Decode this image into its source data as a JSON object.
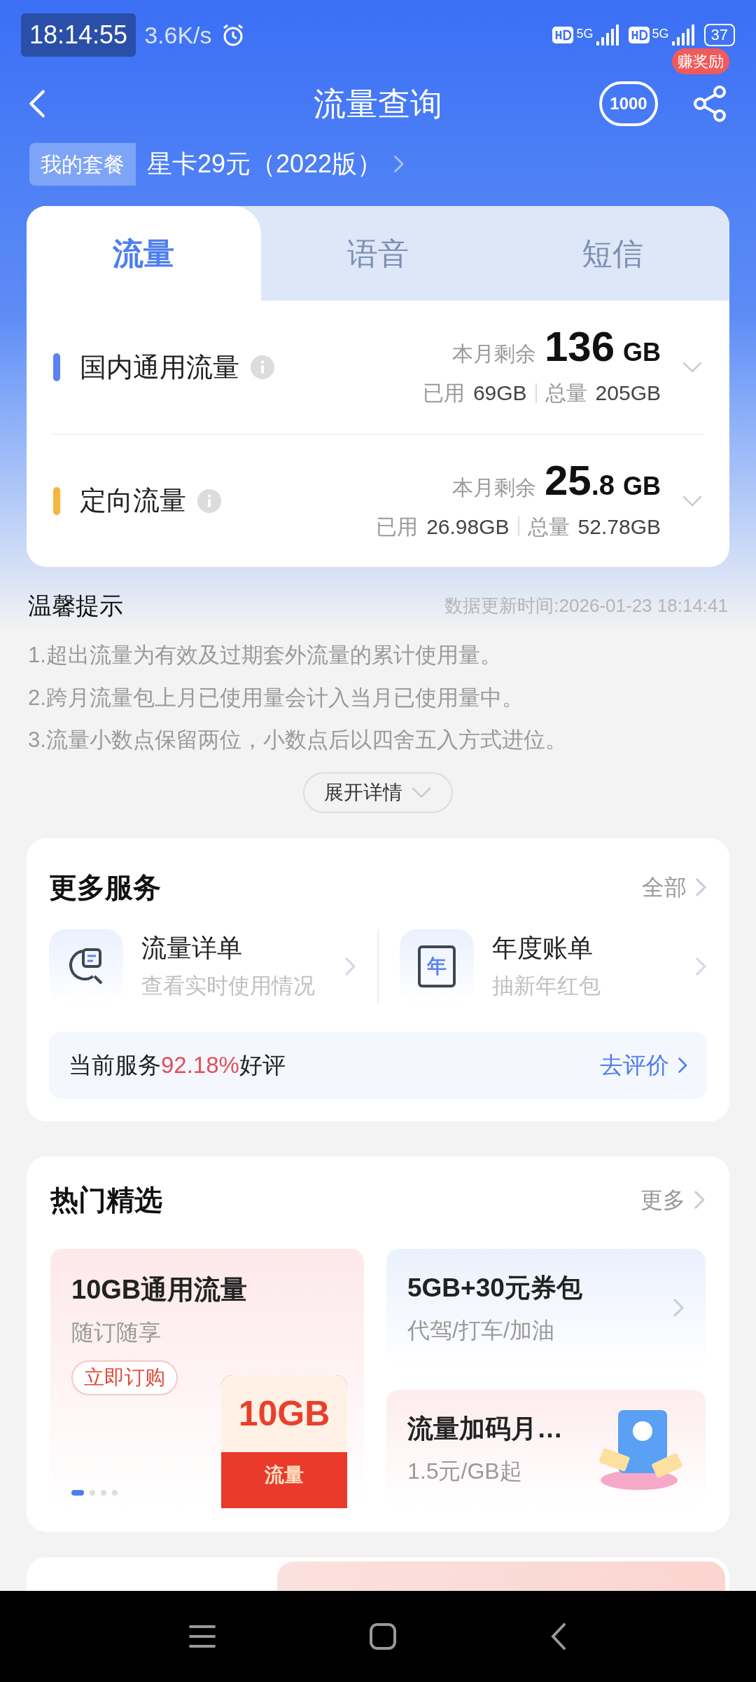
{
  "status_bar": {
    "time": "18:14:55",
    "speed": "3.6K/s",
    "network_1": "5G",
    "network_2": "5G",
    "battery": "37"
  },
  "header": {
    "title": "流量查询",
    "service_badge": "1000",
    "reward_badge": "赚奖励"
  },
  "plan": {
    "label": "我的套餐",
    "name": "星卡29元（2022版）"
  },
  "tabs": [
    {
      "label": "流量",
      "selected": true
    },
    {
      "label": "语音",
      "selected": false
    },
    {
      "label": "短信",
      "selected": false
    }
  ],
  "usage": [
    {
      "name": "国内通用流量",
      "color": "#5b82f0",
      "remain_label": "本月剩余",
      "value": "136",
      "unit": "GB",
      "used_label": "已用",
      "used": "69GB",
      "total_label": "总量",
      "total": "205GB"
    },
    {
      "name": "定向流量",
      "color": "#f5b540",
      "remain_label": "本月剩余",
      "value": "25",
      "fraction": ".8",
      "unit": "GB",
      "used_label": "已用",
      "used": "26.98GB",
      "total_label": "总量",
      "total": "52.78GB"
    }
  ],
  "tips": {
    "title": "温馨提示",
    "updated": "数据更新时间:2026-01-23 18:14:41",
    "items": [
      "1.超出流量为有效及过期套外流量的累计使用量。",
      "2.跨月流量包上月已使用量会计入当月已使用量中。",
      "3.流量小数点保留两位，小数点后以四舍五入方式进位。"
    ],
    "expand": "展开详情"
  },
  "services": {
    "title": "更多服务",
    "more": "全部",
    "items": [
      {
        "kind": "search",
        "title": "流量详单",
        "subtitle": "查看实时使用情况"
      },
      {
        "kind": "calendar",
        "title": "年度账单",
        "subtitle": "抽新年红包",
        "icon_text": "年"
      }
    ],
    "rating_prefix": "当前服务",
    "rating_value": "92.18%",
    "rating_suffix": "好评",
    "rate_link": "去评价"
  },
  "hot": {
    "title": "热门精选",
    "more": "更多",
    "main": {
      "title": "10GB通用流量",
      "subtitle": "随订随享",
      "button": "立即订购",
      "art_text": "10GB",
      "art_label": "流量"
    },
    "dots": [
      {
        "selected": true
      },
      {
        "selected": false
      },
      {
        "selected": false
      },
      {
        "selected": false
      }
    ],
    "side": [
      {
        "title": "5GB+30元券包",
        "subtitle": "代驾/打车/加油"
      },
      {
        "title": "流量加码月…",
        "subtitle": "1.5元/GB起"
      }
    ]
  }
}
